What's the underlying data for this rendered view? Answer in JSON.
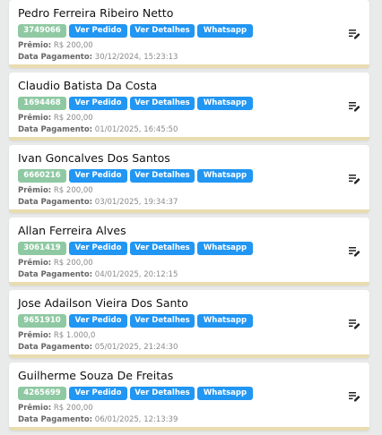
{
  "labels": {
    "ver_pedido": "Ver Pedido",
    "ver_detalhes": "Ver Detalhes",
    "whatsapp": "Whatsapp",
    "premio": "Prêmio:",
    "data_pagamento": "Data Pagamento:"
  },
  "colors": {
    "badge": "#8fc9a3",
    "button": "#2196f3",
    "card_border": "#e8dcb0"
  },
  "icons": {
    "edit": "edit-note-icon"
  },
  "cards": [
    {
      "name": "Pedro Ferreira Ribeiro Netto",
      "id": "3749066",
      "premio": "R$ 200,00",
      "data_pagamento": "30/12/2024, 15:23:13"
    },
    {
      "name": "Claudio Batista Da Costa",
      "id": "1694468",
      "premio": "R$ 200,00",
      "data_pagamento": "01/01/2025, 16:45:50"
    },
    {
      "name": "Ivan Goncalves Dos Santos",
      "id": "6660216",
      "premio": "R$ 200,00",
      "data_pagamento": "03/01/2025, 19:34:37"
    },
    {
      "name": "Allan Ferreira Alves",
      "id": "3061419",
      "premio": "R$ 200,00",
      "data_pagamento": "04/01/2025, 20:12:15"
    },
    {
      "name": "Jose Adailson Vieira Dos Santo",
      "id": "9651910",
      "premio": "R$ 1.000,0",
      "data_pagamento": "05/01/2025, 21:24:30"
    },
    {
      "name": "Guilherme Souza De Freitas",
      "id": "4265699",
      "premio": "R$ 200,00",
      "data_pagamento": "06/01/2025, 12:13:39"
    }
  ]
}
